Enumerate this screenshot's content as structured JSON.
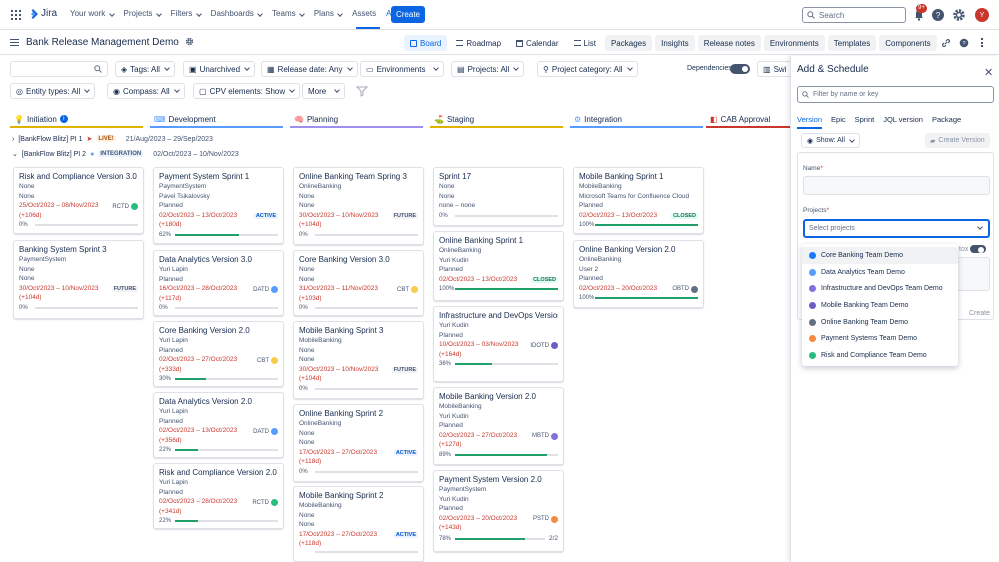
{
  "app": {
    "name": "Jira"
  },
  "nav": {
    "items": [
      "Your work",
      "Projects",
      "Filters",
      "Dashboards",
      "Teams",
      "Plans",
      "Assets",
      "Apps"
    ],
    "create_label": "Create",
    "search_placeholder": "Search",
    "notifications_badge": "9+",
    "avatar_initial": "Y"
  },
  "project": {
    "title": "Bank Release Management Demo",
    "views": [
      "Board",
      "Roadmap",
      "Calendar",
      "List",
      "Packages",
      "Insights",
      "Release notes",
      "Environments",
      "Templates",
      "Components"
    ]
  },
  "filters": {
    "search_placeholder": "",
    "tags": "Tags: All",
    "unarchived": "Unarchived",
    "release_date": "Release date: Any",
    "environments": "Environments",
    "projects": "Projects: All",
    "project_category": "Project category: All",
    "dependencies": "Dependencies",
    "swimlanes": "Swi",
    "entity_types": "Entity types: All",
    "compass": "Compass: All",
    "cpv": "CPV elements: Show",
    "more": "More"
  },
  "columns": [
    {
      "name": "Initiation",
      "color": "#e2b203",
      "info": "i"
    },
    {
      "name": "Development",
      "color": "#579dff"
    },
    {
      "name": "Planning",
      "color": "#9f8fef"
    },
    {
      "name": "Staging",
      "color": "#e2b203"
    },
    {
      "name": "Integration",
      "color": "#579dff"
    },
    {
      "name": "CAB Approval",
      "color": "#c9372c"
    }
  ],
  "pis": [
    {
      "name": "[BankFlow Blitz] PI 1",
      "status": "LIVE!",
      "dates": "21/Aug/2023 – 29/Sep/2023"
    },
    {
      "name": "[BankFlow Blitz] PI 2",
      "status": "INTEGRATION",
      "dates": "02/Oct/2023 – 10/Nov/2023"
    }
  ],
  "cards": {
    "col1": [
      {
        "title": "Risk and Compliance Version 3.0",
        "lines": [
          "None",
          "None"
        ],
        "dates": "25/Oct/2023 – 08/Nov/2023",
        "delay": "(+106d)",
        "tag": "RCTD",
        "percent": "0%",
        "progress": 0
      },
      {
        "title": "Banking System Sprint 3",
        "lines": [
          "PaymentSystem",
          "None",
          "None"
        ],
        "dates": "30/Oct/2023 – 10/Nov/2023",
        "delay": "(+104d)",
        "status": "FUTURE",
        "percent": "0%",
        "progress": 0
      }
    ],
    "col2": [
      {
        "title": "Payment System Sprint 1",
        "lines": [
          "PaymentSystem",
          "Pavel Tsikalovsky",
          "Planned"
        ],
        "dates": "02/Oct/2023 – 13/Oct/2023",
        "delay": "(+180d)",
        "status": "ACTIVE",
        "percent": "62%",
        "progress": 62
      },
      {
        "title": "Data Analytics Version 3.0",
        "lines": [
          "Yuri Lapin",
          "Planned"
        ],
        "dates": "16/Oct/2023 – 28/Oct/2023",
        "delay": "(+117d)",
        "tag": "DATD",
        "percent": "0%",
        "progress": 0
      },
      {
        "title": "Core Banking Version 2.0",
        "lines": [
          "Yuri Lapin",
          "Planned"
        ],
        "dates": "02/Oct/2023 – 27/Oct/2023",
        "delay": "(+333d)",
        "tag": "CBT",
        "percent": "30%",
        "progress": 30
      },
      {
        "title": "Data Analytics Version 2.0",
        "lines": [
          "Yuri Lapin",
          "Planned"
        ],
        "dates": "02/Oct/2023 – 13/Oct/2023",
        "delay": "(+356d)",
        "tag": "DATD",
        "percent": "22%",
        "progress": 22
      },
      {
        "title": "Risk and Compliance Version 2.0",
        "lines": [
          "Yuri Lapin",
          "Planned"
        ],
        "dates": "02/Oct/2023 – 28/Oct/2023",
        "delay": "(+341d)",
        "tag": "RCTD",
        "percent": "22%",
        "progress": 22
      }
    ],
    "col3": [
      {
        "title": "Online Banking Team Spring 3",
        "lines": [
          "OnlineBanking",
          "None",
          "None"
        ],
        "dates": "30/Oct/2023 – 10/Nov/2023",
        "delay": "(+104d)",
        "status": "FUTURE",
        "percent": "0%",
        "progress": 0
      },
      {
        "title": "Core Banking Version 3.0",
        "lines": [
          "None",
          "None"
        ],
        "dates": "31/Oct/2023 – 11/Nov/2023",
        "delay": "(+103d)",
        "tag": "CBT",
        "percent": "0%",
        "progress": 0
      },
      {
        "title": "Mobile Banking Sprint 3",
        "lines": [
          "MobileBanking",
          "None",
          "None"
        ],
        "dates": "30/Oct/2023 – 10/Nov/2023",
        "delay": "(+104d)",
        "status": "FUTURE",
        "percent": "0%",
        "progress": 0
      },
      {
        "title": "Online Banking Sprint 2",
        "lines": [
          "OnlineBanking",
          "None",
          "None"
        ],
        "dates": "17/Oct/2023 – 27/Oct/2023",
        "delay": "(+118d)",
        "status": "ACTIVE",
        "percent": "0%",
        "progress": 0
      },
      {
        "title": "Mobile Banking Sprint 2",
        "lines": [
          "MobileBanking",
          "None",
          "None"
        ],
        "dates": "17/Oct/2023 – 27/Oct/2023",
        "delay": "(+118d)",
        "status": "ACTIVE",
        "percent": "",
        "progress": 0
      }
    ],
    "col4": [
      {
        "title": "Sprint 17",
        "lines": [
          "None",
          "None",
          "none – none"
        ],
        "dates": "",
        "delay": "",
        "percent": "0%",
        "progress": 0
      },
      {
        "title": "Online Banking Sprint 1",
        "lines": [
          "OnlineBanking",
          "Yuri Kudin",
          "Planned"
        ],
        "dates": "02/Oct/2023 – 13/Oct/2023",
        "delay": "",
        "status": "CLOSED",
        "percent": "100%",
        "progress": 100
      },
      {
        "title": "Infrastructure and DevOps Version 2.0",
        "lines": [
          "Yuri Kudin",
          "Planned"
        ],
        "dates": "10/Oct/2023 – 03/Nov/2023",
        "delay": "(+164d)",
        "tag": "IDOTD",
        "percent": "36%",
        "progress": 36
      },
      {
        "title": "Mobile Banking Version 2.0",
        "lines": [
          "MobileBanking",
          "Yuri Kudin",
          "Planned"
        ],
        "dates": "02/Oct/2023 – 27/Oct/2023",
        "delay": "(+127d)",
        "tag": "MBTD",
        "percent": "89%",
        "progress": 89
      },
      {
        "title": "Payment System Version 2.0",
        "lines": [
          "PaymentSystem",
          "Yuri Kudin",
          "Planned"
        ],
        "dates": "02/Oct/2023 – 20/Oct/2023",
        "delay": "(+143d)",
        "tag": "PSTD",
        "percent": "78%",
        "progress": 78,
        "extra": "2/2"
      }
    ],
    "col5": [
      {
        "title": "Mobile Banking Sprint 1",
        "lines": [
          "MobileBanking",
          "Microsoft Teams for Confluence Cloud",
          "Planned"
        ],
        "dates": "02/Oct/2023 – 13/Oct/2023",
        "delay": "",
        "status": "CLOSED",
        "percent": "100%",
        "progress": 100
      },
      {
        "title": "Online Banking Version 2.0",
        "lines": [
          "OnlineBanking",
          "User 2",
          "Planned"
        ],
        "dates": "02/Oct/2023 – 20/Oct/2023",
        "delay": "",
        "tag": "OBTD",
        "percent": "100%",
        "progress": 100
      }
    ]
  },
  "panel": {
    "title": "Add & Schedule",
    "filter_placeholder": "Filter by name or key",
    "tabs": [
      "Version",
      "Epic",
      "Sprint",
      "JQL version",
      "Package"
    ],
    "show": "Show: All",
    "create_version": "Create Version",
    "name_label": "Name",
    "projects_label": "Projects",
    "projects_placeholder": "Select projects",
    "ghost_tox": "tox",
    "ghost_create": "Create",
    "options": [
      {
        "name": "Core Banking Team Demo",
        "color": "#1d7afc"
      },
      {
        "name": "Data Analytics Team Demo",
        "color": "#579dff"
      },
      {
        "name": "Infrastructure and DevOps Team Demo",
        "color": "#8270db"
      },
      {
        "name": "Mobile Banking Team Demo",
        "color": "#6e5dc6"
      },
      {
        "name": "Online Banking Team Demo",
        "color": "#626f86"
      },
      {
        "name": "Payment Systems Team Demo",
        "color": "#f38a3f"
      },
      {
        "name": "Risk and Compliance Team Demo",
        "color": "#2abb7f"
      }
    ]
  }
}
